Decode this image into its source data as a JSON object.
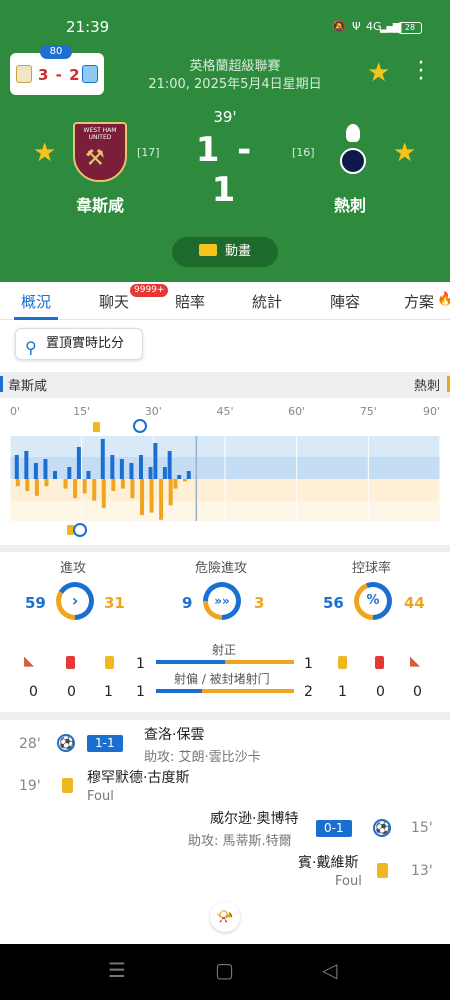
{
  "status_bar": {
    "time": "21:39",
    "battery": "28",
    "net_label": "4G"
  },
  "mini_score": {
    "badge": "80",
    "score": "3 - 2"
  },
  "match": {
    "league": "英格蘭超級聯賽",
    "kickoff": "21:00, 2025年5月4日星期日",
    "minute": "39'",
    "score": "1 - 1",
    "home": {
      "name": "韋斯咸",
      "rank": "[17]",
      "crest_text": "WEST HAM UNITED"
    },
    "away": {
      "name": "熱刺",
      "rank": "[16]"
    }
  },
  "animation_button": "動畫",
  "tabs": [
    "概況",
    "聊天",
    "賠率",
    "統計",
    "陣容",
    "方案"
  ],
  "chat_badge": "9999+",
  "pin_button": "置頂實時比分",
  "momentum": {
    "home_label": "韋斯咸",
    "away_label": "熱刺",
    "ticks": [
      "0'",
      "15'",
      "30'",
      "45'",
      "60'",
      "75'",
      "90'"
    ],
    "current_minute": 39,
    "home_bars": [
      [
        1,
        12
      ],
      [
        3,
        14
      ],
      [
        5,
        8
      ],
      [
        7,
        10
      ],
      [
        9,
        4
      ],
      [
        12,
        6
      ],
      [
        14,
        16
      ],
      [
        16,
        4
      ],
      [
        19,
        20
      ],
      [
        21,
        12
      ],
      [
        23,
        10
      ],
      [
        25,
        8
      ],
      [
        27,
        12
      ],
      [
        29,
        6
      ],
      [
        30,
        18
      ],
      [
        32,
        6
      ],
      [
        33,
        14
      ],
      [
        35,
        2
      ],
      [
        37,
        4
      ]
    ],
    "away_bars": [
      [
        1,
        6
      ],
      [
        3,
        10
      ],
      [
        5,
        14
      ],
      [
        7,
        6
      ],
      [
        11,
        8
      ],
      [
        13,
        16
      ],
      [
        15,
        12
      ],
      [
        17,
        18
      ],
      [
        19,
        24
      ],
      [
        21,
        10
      ],
      [
        23,
        8
      ],
      [
        25,
        16
      ],
      [
        27,
        30
      ],
      [
        29,
        28
      ],
      [
        31,
        34
      ],
      [
        33,
        22
      ],
      [
        34,
        8
      ],
      [
        36,
        2
      ]
    ]
  },
  "stats": {
    "attack": {
      "label": "進攻",
      "home": "59",
      "away": "31",
      "home_share": 0.66
    },
    "danger": {
      "label": "危險進攻",
      "home": "9",
      "away": "3",
      "home_share": 0.75
    },
    "possession": {
      "label": "控球率",
      "home": "56",
      "away": "44",
      "home_share": 0.56
    },
    "shots_on": {
      "label": "射正",
      "home": "1",
      "away": "1"
    },
    "shots_off": {
      "label": "射偏 / 被封堵射门",
      "home": "1",
      "away": "2"
    },
    "home_corners": "0",
    "home_red": "0",
    "home_yellow": "1",
    "away_yellow": "1",
    "away_red": "0",
    "away_corners": "0"
  },
  "events": [
    {
      "side": "home",
      "minute": "28'",
      "score": "1-1",
      "player": "查洛·保雲",
      "assist": "助攻: 艾朗·雲比沙卡"
    },
    {
      "side": "home",
      "minute": "19'",
      "player": "穆罕默德·古度斯",
      "note": "Foul"
    },
    {
      "side": "away",
      "minute": "15'",
      "score": "0-1",
      "player": "威尔逊·奥博特",
      "assist": "助攻: 馬蒂斯.特爾"
    },
    {
      "side": "away",
      "minute": "13'",
      "player": "賓·戴維斯",
      "note": "Foul"
    }
  ],
  "colors": {
    "header_green": "#2e8b3e",
    "home_blue": "#1b6fd1",
    "away_orange": "#f0a520"
  }
}
